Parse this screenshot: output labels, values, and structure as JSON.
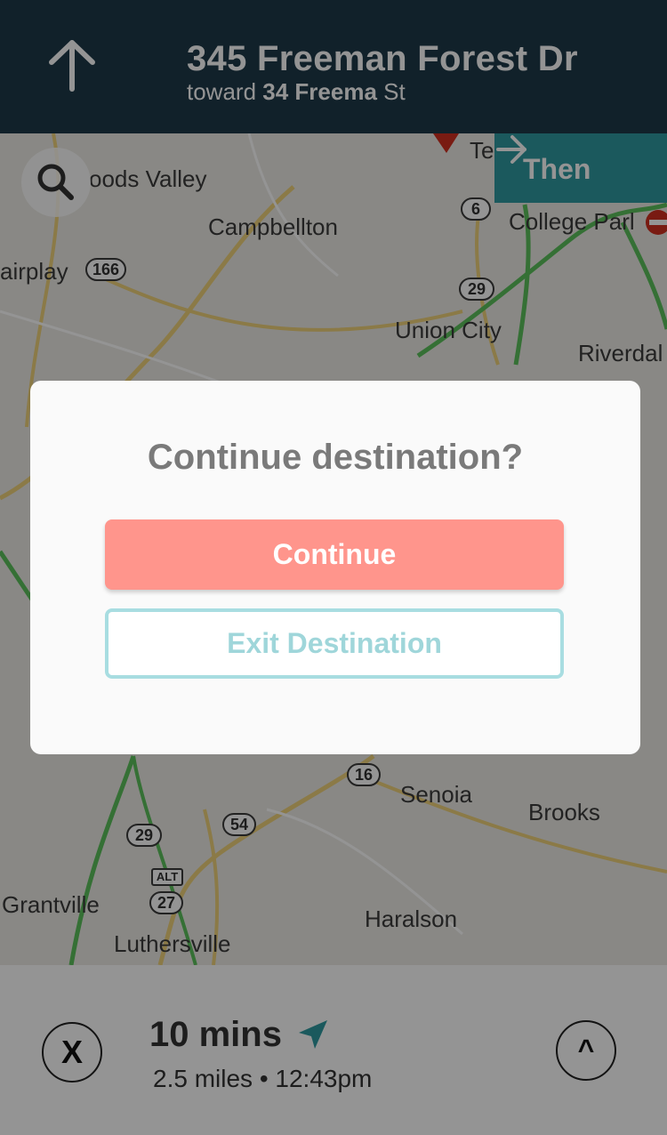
{
  "header": {
    "street": "345 Freeman Forest Dr",
    "toward_prefix": "toward",
    "toward_street": "34 Freema",
    "toward_suffix": "St"
  },
  "map": {
    "then_label": "Then",
    "places": [
      "oods Valley",
      "Campbellton",
      "airplay",
      "Union City",
      "College Parl",
      "Riverdal",
      "Senoia",
      "Brooks",
      "Grantville",
      "Haralson",
      "Luthersville",
      "Te"
    ],
    "routes": [
      "6",
      "166",
      "29",
      "16",
      "29",
      "54",
      "27"
    ],
    "alt_label": "ALT"
  },
  "modal": {
    "title": "Continue destination?",
    "continue_label": "Continue",
    "exit_label": "Exit Destination"
  },
  "bottom": {
    "close_label": "X",
    "eta": "10 mins",
    "trip_info": "2.5 miles • 12:43pm",
    "expand_label": "^"
  },
  "colors": {
    "header_bg": "#1e3a49",
    "then_bg": "#2f9aa0",
    "continue_bg": "#ff958c",
    "exit_border": "#a8dde1"
  }
}
